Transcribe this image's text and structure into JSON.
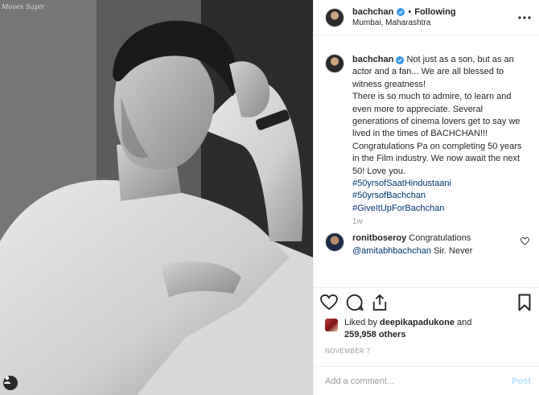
{
  "photo": {
    "watermark": "Moses Sapir",
    "alt": "Black and white portrait of young man resting arm on chair"
  },
  "header": {
    "username": "bachchan",
    "separator": "•",
    "follow_state": "Following",
    "location": "Mumbai, Maharashtra"
  },
  "caption": {
    "username": "bachchan",
    "lines": [
      "Not just as a son, but as an actor and a fan... We are all blessed to witness greatness!",
      "There is so much to admire, to learn and even more to appreciate. Several generations of cinema lovers get to say we lived in the times of BACHCHAN!!! Congratulations Pa on completing 50 years in the Film industry. We now await the next 50! Love you."
    ],
    "hashtags": [
      "#50yrsofSaatHindustaani",
      "#50yrsofBachchan",
      "#GiveItUpForBachchan"
    ],
    "time": "1w"
  },
  "reply": {
    "username": "ronitboseroy",
    "text_before": "Congratulations",
    "mention": "@amitabhbachchan",
    "text_after": "Sir. Never"
  },
  "likes": {
    "prefix": "Liked by",
    "user": "deepikapadukone",
    "and": "and",
    "count": "259,958 others"
  },
  "date": "NOVEMBER 7",
  "comment_box": {
    "placeholder": "Add a comment...",
    "post_label": "Post"
  },
  "colors": {
    "verified": "#3897f0",
    "hashtag": "#003569",
    "post_disabled": "#b2dffc"
  }
}
